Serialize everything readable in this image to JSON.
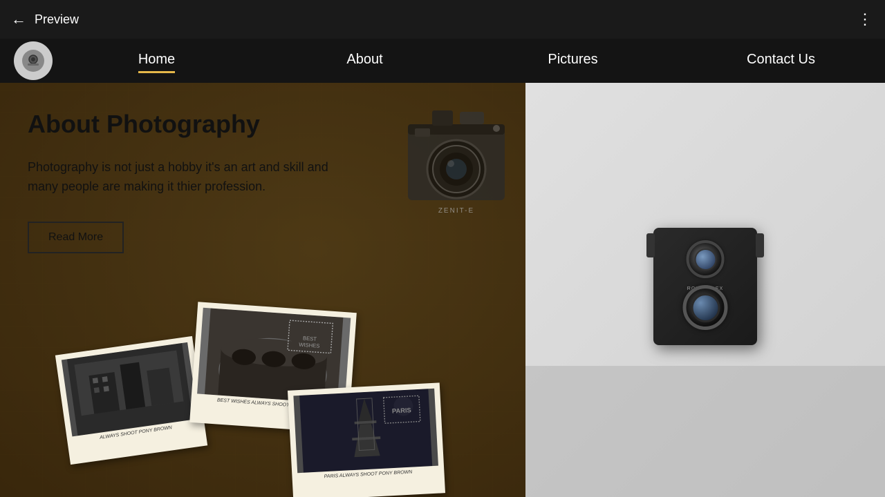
{
  "topbar": {
    "title": "Preview",
    "back_label": "←",
    "more_icon": "⋮"
  },
  "nav": {
    "logo_alt": "Photography Logo",
    "links": [
      {
        "id": "home",
        "label": "Home",
        "active": true
      },
      {
        "id": "about",
        "label": "About",
        "active": false
      },
      {
        "id": "pictures",
        "label": "Pictures",
        "active": false
      },
      {
        "id": "contact",
        "label": "Contact Us",
        "active": false
      }
    ]
  },
  "hero": {
    "title": "About Photography",
    "description": "Photography is not just a hobby it's an art and skill and many people are making it thier profession.",
    "cta_label": "Read More"
  },
  "polaroids": [
    {
      "id": "polaroid-1",
      "label": "ALWAYS SHOOT\nPONY BROWN"
    },
    {
      "id": "polaroid-2",
      "label": "BEST WISHES\nALWAYS SHOOT\nPONY BROWN"
    },
    {
      "id": "polaroid-3",
      "label": "PARIS\nALWAYS SHOOT\nPONY BROWN"
    }
  ],
  "camera": {
    "brand": "ROLLEIFLEX"
  },
  "colors": {
    "accent": "#e6b84a",
    "nav_bg": "#1a1a1a",
    "left_bg": "#7a5c2a",
    "right_bg": "#e0e0e0",
    "title_color": "#111111",
    "btn_border": "#222222"
  }
}
